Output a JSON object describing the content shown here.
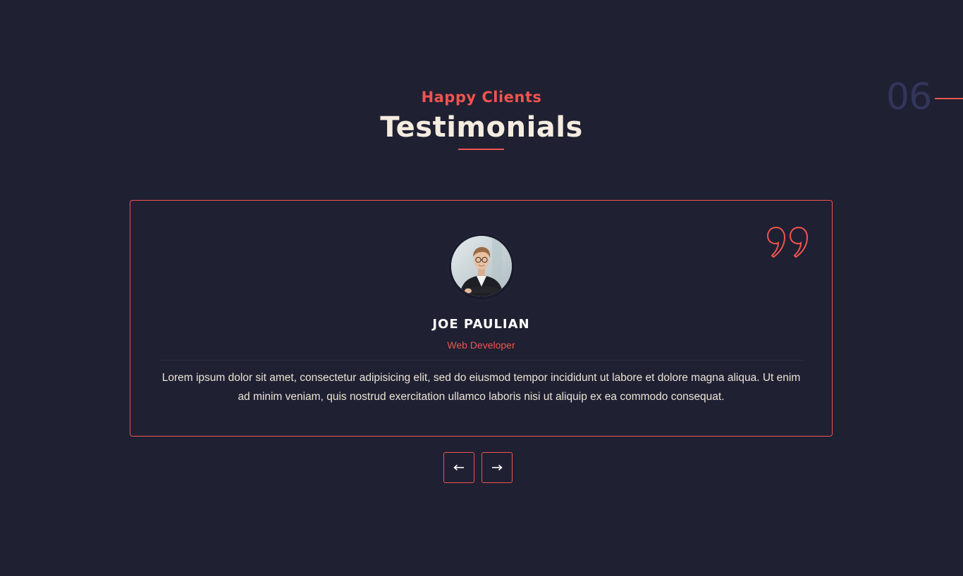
{
  "section": {
    "number": "06",
    "eyebrow": "Happy Clients",
    "title": "Testimonials"
  },
  "testimonial": {
    "name": "JOE PAULIAN",
    "role": "Web Developer",
    "quote": "Lorem ipsum dolor sit amet, consectetur adipisicing elit, sed do eiusmod tempor incididunt ut labore et dolore magna aliqua. Ut enim ad minim veniam, quis nostrud exercitation ullamco laboris nisi ut aliquip ex ea commodo consequat.",
    "avatar_icon": "person-photo",
    "quote_icon": "quote-marks-icon"
  },
  "navigation": {
    "prev_icon": "arrow-left-icon",
    "next_icon": "arrow-right-icon"
  },
  "colors": {
    "background": "#1f2032",
    "accent": "#f0544f",
    "title_text": "#f5ecdf",
    "section_number": "#33355a"
  }
}
